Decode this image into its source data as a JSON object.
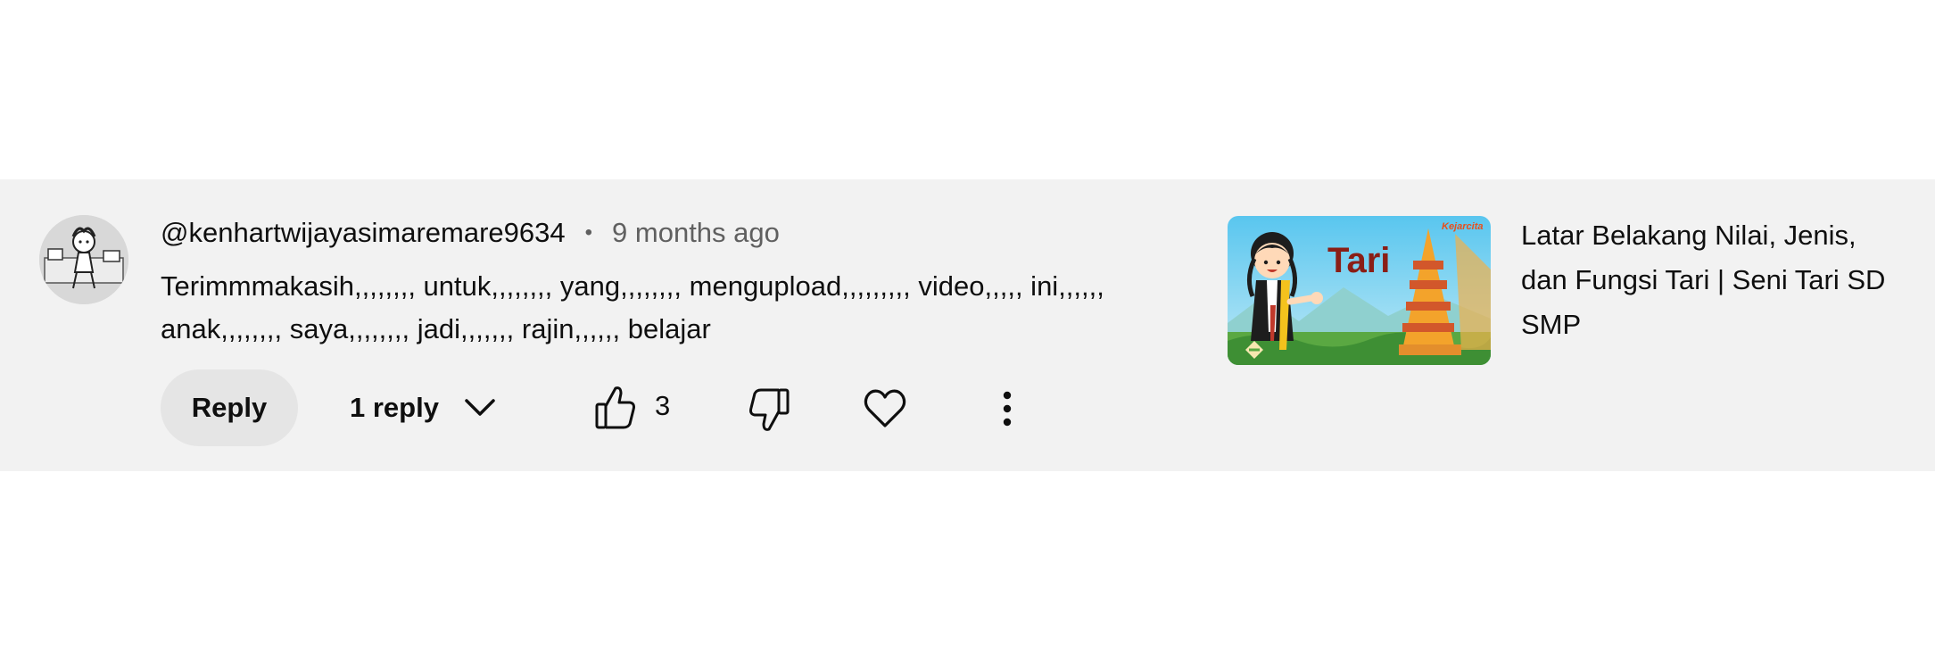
{
  "comment": {
    "author": "@kenhartwijayasimaremare9634",
    "separator": "•",
    "time": "9 months ago",
    "text": "Terimmmakasih,,,,,,,, untuk,,,,,,,, yang,,,,,,,, mengupload,,,,,,,,, video,,,,, ini,,,,,, anak,,,,,,,, saya,,,,,,,, jadi,,,,,,, rajin,,,,,, belajar",
    "actions": {
      "reply_label": "Reply",
      "replies_label": "1 reply",
      "like_count": "3"
    },
    "icons": {
      "avatar": "avatar-image",
      "chevron": "chevron-down-icon",
      "like": "thumbs-up-icon",
      "dislike": "thumbs-down-icon",
      "heart": "heart-icon",
      "more": "more-vertical-icon"
    }
  },
  "video": {
    "title": "Latar Belakang Nilai, Jenis, dan Fungsi Tari | Seni Tari SD SMP",
    "thumbnail_text": "Tari",
    "thumbnail_brand": "Kejarcita",
    "colors": {
      "sky": "#5ec8ef",
      "title": "#8a1e16",
      "temple": "#f3a32b",
      "grass": "#5aa842"
    }
  },
  "colors": {
    "band_background": "#f2f2f2",
    "secondary_text": "#606060",
    "reply_button": "#e5e5e5"
  }
}
